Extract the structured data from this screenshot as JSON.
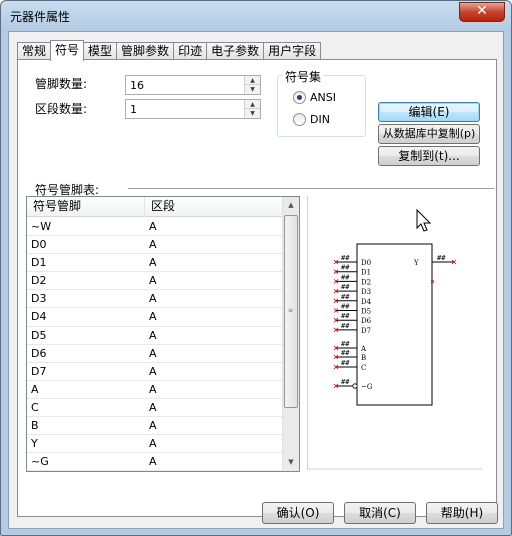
{
  "window": {
    "title": "元器件属性",
    "close_glyph": "✕"
  },
  "tabs": [
    {
      "label": "常规"
    },
    {
      "label": "符号",
      "active": true
    },
    {
      "label": "模型"
    },
    {
      "label": "管脚参数"
    },
    {
      "label": "印迹"
    },
    {
      "label": "电子参数"
    },
    {
      "label": "用户字段"
    }
  ],
  "fields": {
    "pin_count_label": "管脚数量:",
    "pin_count_value": "16",
    "section_count_label": "区段数量:",
    "section_count_value": "1"
  },
  "symbol_set": {
    "title": "符号集",
    "options": [
      {
        "label": "ANSI",
        "checked": true
      },
      {
        "label": "DIN",
        "checked": false
      }
    ]
  },
  "buttons": {
    "edit": "编辑(E)",
    "copy_from_db": "从数据库中复制(p)",
    "copy_to": "复制到(t)...",
    "ok": "确认(O)",
    "cancel": "取消(C)",
    "help": "帮助(H)"
  },
  "pin_table": {
    "label": "符号管脚表:",
    "columns": [
      "符号管脚",
      "区段"
    ],
    "rows": [
      [
        "~W",
        "A"
      ],
      [
        "D0",
        "A"
      ],
      [
        "D1",
        "A"
      ],
      [
        "D2",
        "A"
      ],
      [
        "D3",
        "A"
      ],
      [
        "D4",
        "A"
      ],
      [
        "D5",
        "A"
      ],
      [
        "D6",
        "A"
      ],
      [
        "D7",
        "A"
      ],
      [
        "A",
        "A"
      ],
      [
        "C",
        "A"
      ],
      [
        "B",
        "A"
      ],
      [
        "Y",
        "A"
      ],
      [
        "~G",
        "A"
      ]
    ]
  },
  "symbol_preview": {
    "left_pins": [
      "D0",
      "D1",
      "D2",
      "D3",
      "D4",
      "D5",
      "D6",
      "D7",
      "A",
      "B",
      "C",
      "~G"
    ],
    "right_pins": [
      "Y"
    ],
    "pin_number_placeholder": "##",
    "colors": {
      "outline": "#000000",
      "pin_marker": "#cc0000"
    }
  }
}
